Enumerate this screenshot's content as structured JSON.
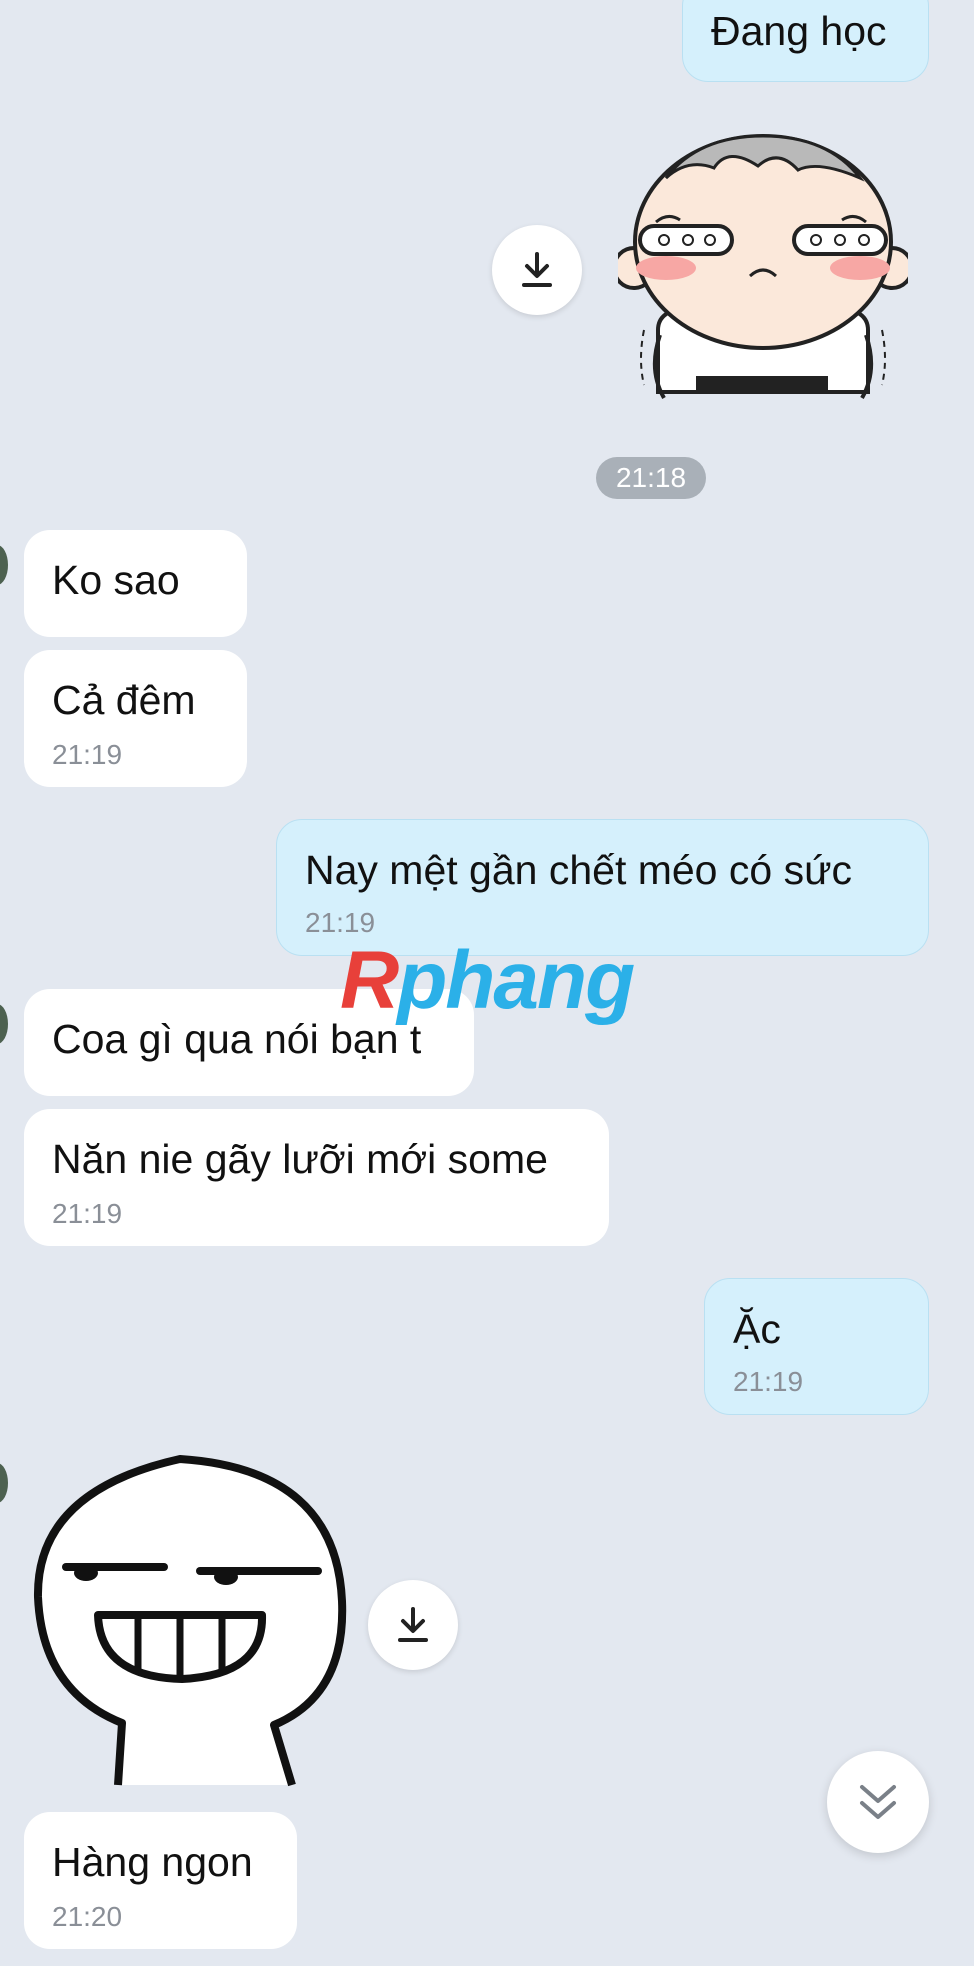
{
  "messages": [
    {
      "id": "m1",
      "dir": "out",
      "text": "Đang học"
    },
    {
      "id": "m2",
      "dir": "out",
      "type": "sticker",
      "sticker": "crying-baby-sticker"
    },
    {
      "id": "m3",
      "dir": "in",
      "text": "Ko sao"
    },
    {
      "id": "m4",
      "dir": "in",
      "text": "Cả đêm",
      "time": "21:19"
    },
    {
      "id": "m5",
      "dir": "out",
      "text": "Nay mệt gần chết méo có sức",
      "time": "21:19"
    },
    {
      "id": "m6",
      "dir": "in",
      "text": "Coa gì qua nói bạn t"
    },
    {
      "id": "m7",
      "dir": "in",
      "text": "Năn nie gãy lưỡi mới some",
      "time": "21:19"
    },
    {
      "id": "m8",
      "dir": "out",
      "text": "Ặc",
      "time": "21:19"
    },
    {
      "id": "m9",
      "dir": "in",
      "type": "sticker",
      "sticker": "smirking-grin-sticker"
    },
    {
      "id": "m10",
      "dir": "in",
      "text": "Hàng ngon",
      "time": "21:20"
    }
  ],
  "separator_time": "21:18",
  "watermark": {
    "first": "R",
    "rest": "phang"
  },
  "icons": {
    "download": "download-icon",
    "scroll": "double-chevron-down-icon"
  },
  "colors": {
    "background": "#e3e8f0",
    "incoming_bubble": "#ffffff",
    "outgoing_bubble": "#d5f0fc",
    "timestamp": "#8a8f97",
    "watermark_red": "#e8403a",
    "watermark_blue": "#2bb0e8"
  }
}
